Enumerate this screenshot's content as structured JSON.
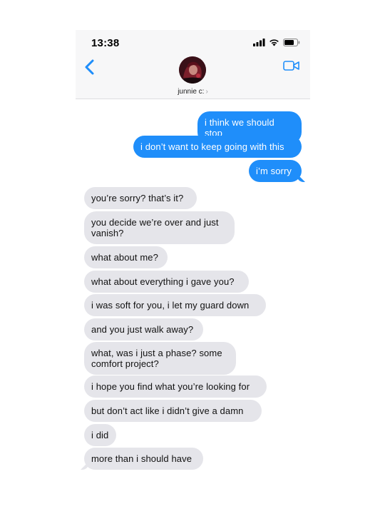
{
  "status": {
    "time": "13:38"
  },
  "contact": {
    "name": "junnie c:",
    "chevron": "›"
  },
  "icons": {
    "back": "chevron-left-icon",
    "video": "video-camera-icon",
    "signal": "cellular-signal-icon",
    "wifi": "wifi-icon",
    "battery": "battery-icon"
  },
  "colors": {
    "sent": "#1f8efa",
    "received": "#e5e5ea",
    "accent": "#1f8efa"
  },
  "messages": [
    {
      "from": "me",
      "text": "i think we should stop"
    },
    {
      "from": "me",
      "text": "i don’t want to keep going with this"
    },
    {
      "from": "me",
      "text": "i’m sorry"
    },
    {
      "from": "them",
      "text": "you’re sorry? that’s it?"
    },
    {
      "from": "them",
      "text": "you decide we’re over and just vanish?"
    },
    {
      "from": "them",
      "text": "what about me?"
    },
    {
      "from": "them",
      "text": "what about everything i gave you?"
    },
    {
      "from": "them",
      "text": "i was soft for you, i let my guard down"
    },
    {
      "from": "them",
      "text": "and you just walk away?"
    },
    {
      "from": "them",
      "text": "what, was i just a phase? some comfort project?"
    },
    {
      "from": "them",
      "text": "i hope you find what you’re looking for"
    },
    {
      "from": "them",
      "text": "but don’t act like i didn’t give a damn"
    },
    {
      "from": "them",
      "text": "i did"
    },
    {
      "from": "them",
      "text": "more than i should have"
    }
  ]
}
